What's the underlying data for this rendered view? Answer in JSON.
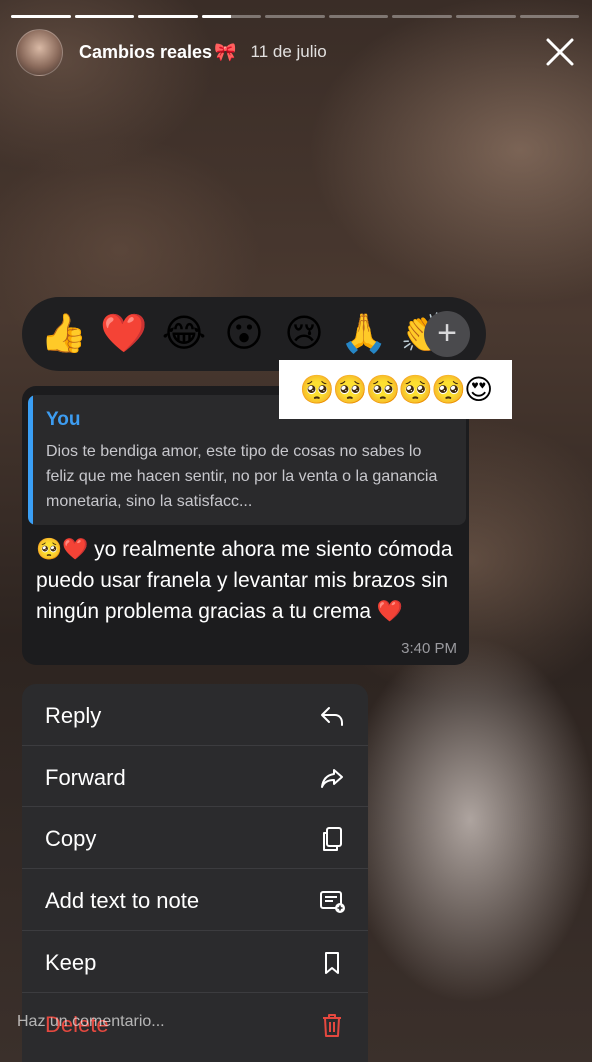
{
  "story": {
    "progress_segments": [
      1,
      1,
      1,
      0.5,
      0,
      0,
      0,
      0,
      0
    ],
    "username": "Cambios reales",
    "username_emoji": "🎀",
    "date": "11 de julio",
    "close_icon": "close-icon"
  },
  "reactions": {
    "emojis": [
      "👍",
      "❤️",
      "😂",
      "😮",
      "😢",
      "🙏",
      "👏"
    ],
    "more_icon": "+"
  },
  "sticker": {
    "emojis": "🥺🥺🥺🥺🥺😍"
  },
  "message": {
    "quote_author": "You",
    "quote_text": "Dios te bendiga amor, este tipo de cosas no sabes lo feliz que me hacen sentir, no por la venta o la ganancia monetaria, sino la satisfacc...",
    "body": "🥺❤️ yo realmente ahora me siento cómoda puedo usar franela y levantar mis brazos sin ningún problema gracias a tu crema ❤️",
    "time": "3:40 PM"
  },
  "menu": {
    "items": [
      {
        "label": "Reply",
        "icon": "reply-icon"
      },
      {
        "label": "Forward",
        "icon": "forward-icon"
      },
      {
        "label": "Copy",
        "icon": "copy-icon"
      },
      {
        "label": "Add text to note",
        "icon": "note-add-icon"
      },
      {
        "label": "Keep",
        "icon": "bookmark-icon"
      },
      {
        "label": "Delete",
        "icon": "trash-icon"
      }
    ]
  },
  "comment": {
    "placeholder": "Haz un comentario..."
  },
  "colors": {
    "accent": "#3a9ff5",
    "danger": "#e5483f",
    "bubble": "#1c1c1e",
    "menu": "#2b2b2d"
  }
}
